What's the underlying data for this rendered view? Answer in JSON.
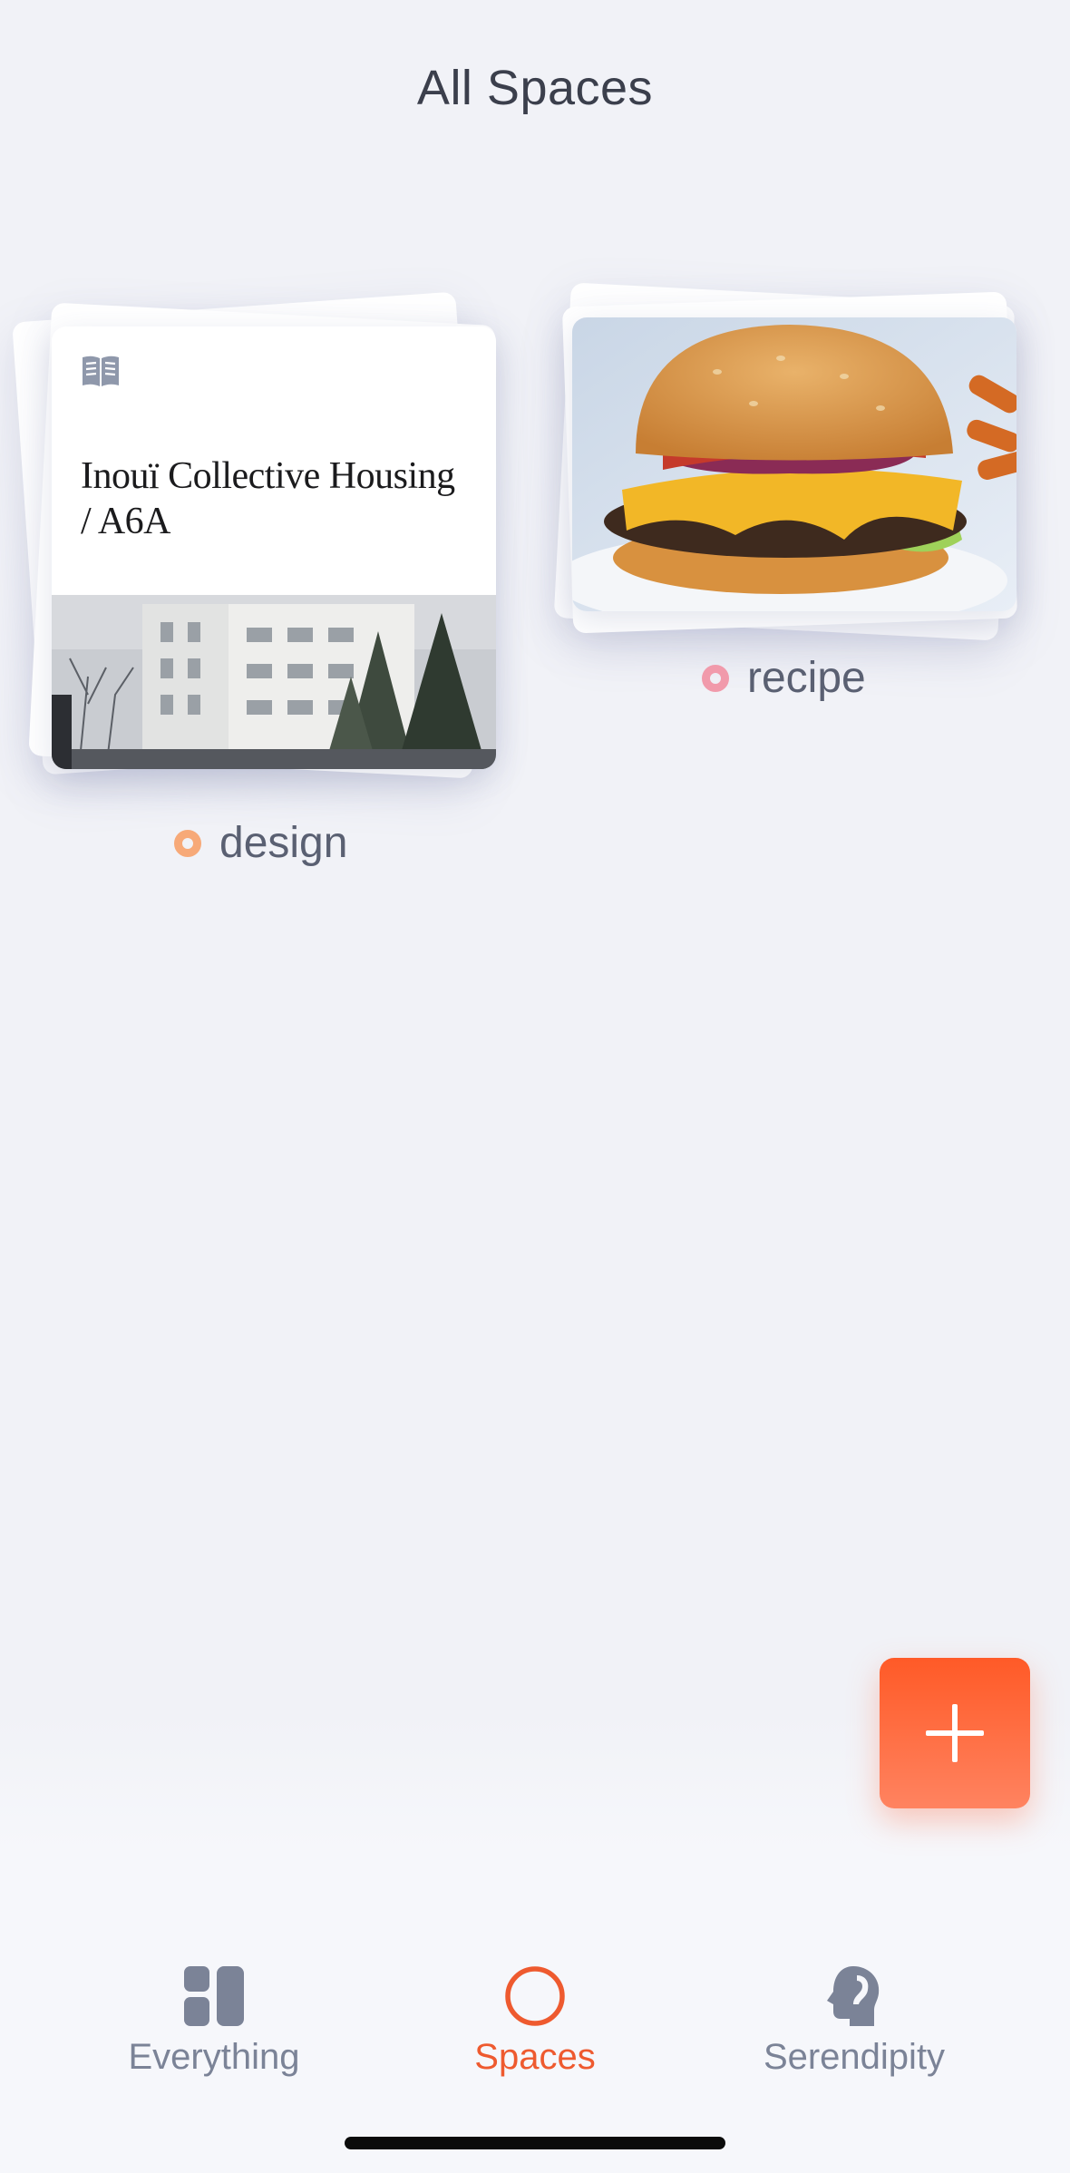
{
  "header": {
    "title": "All Spaces"
  },
  "spaces": [
    {
      "name": "design",
      "ring_color": "#f7a978",
      "cover": {
        "kind": "article",
        "icon": "reader-icon",
        "title": "Inouï Collective Housing / A6A"
      }
    },
    {
      "name": "recipe",
      "ring_color": "#f19aab",
      "cover": {
        "kind": "image",
        "icon": "burger-photo"
      }
    }
  ],
  "fab": {
    "icon": "plus-icon",
    "color": "#ff6a3d"
  },
  "bottom_nav": {
    "tabs": [
      {
        "label": "Everything",
        "icon": "grid-icon",
        "active": false
      },
      {
        "label": "Spaces",
        "icon": "circle-icon",
        "active": true
      },
      {
        "label": "Serendipity",
        "icon": "head-icon",
        "active": false
      }
    ],
    "active_color": "#ee5a2f",
    "inactive_color": "#7b8397"
  }
}
